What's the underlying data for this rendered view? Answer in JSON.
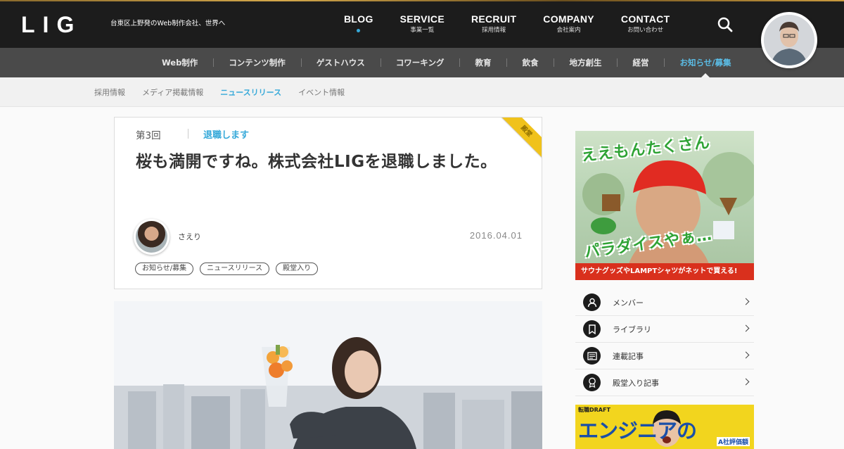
{
  "header": {
    "logo": "LIG",
    "tagline": "台東区上野発のWeb制作会社、世界へ",
    "nav": [
      {
        "en": "BLOG",
        "ja": ""
      },
      {
        "en": "SERVICE",
        "ja": "事業一覧"
      },
      {
        "en": "RECRUIT",
        "ja": "採用情報"
      },
      {
        "en": "COMPANY",
        "ja": "会社案内"
      },
      {
        "en": "CONTACT",
        "ja": "お問い合わせ"
      }
    ],
    "search_icon": "search-icon"
  },
  "categories": [
    "Web制作",
    "コンテンツ制作",
    "ゲストハウス",
    "コワーキング",
    "教育",
    "飲食",
    "地方創生",
    "経営",
    "お知らせ/募集"
  ],
  "subcategories": [
    "採用情報",
    "メディア掲載情報",
    "ニュースリリース",
    "イベント情報"
  ],
  "article": {
    "series": "第3回",
    "series_name": "退職します",
    "title": "桜も満開ですね。株式会社LIGを退職しました。",
    "author": "さえり",
    "date": "2016.04.01",
    "tags": [
      "お知らせ/募集",
      "ニュースリリース",
      "殿堂入り"
    ],
    "ribbon": "殿堂"
  },
  "sidebar": {
    "banner1": {
      "headline": "ええもんたくさん",
      "headline2": "パラダイスやぁ…",
      "caption": "サウナグッズやLAMPTシャツがネットで買える!"
    },
    "menu": [
      {
        "label": "メンバー",
        "icon": "person-icon"
      },
      {
        "label": "ライブラリ",
        "icon": "bookmark-icon"
      },
      {
        "label": "連載記事",
        "icon": "news-icon"
      },
      {
        "label": "殿堂入り記事",
        "icon": "award-icon"
      }
    ],
    "banner2": {
      "brand": "転職DRAFT",
      "headline": "エンジニアの",
      "sub": "A社評価額"
    }
  },
  "colors": {
    "accent": "#36a9d9",
    "header_bg": "#1c1c1c",
    "catbar_bg": "#4a4a4a",
    "ribbon": "#f0c21b"
  }
}
